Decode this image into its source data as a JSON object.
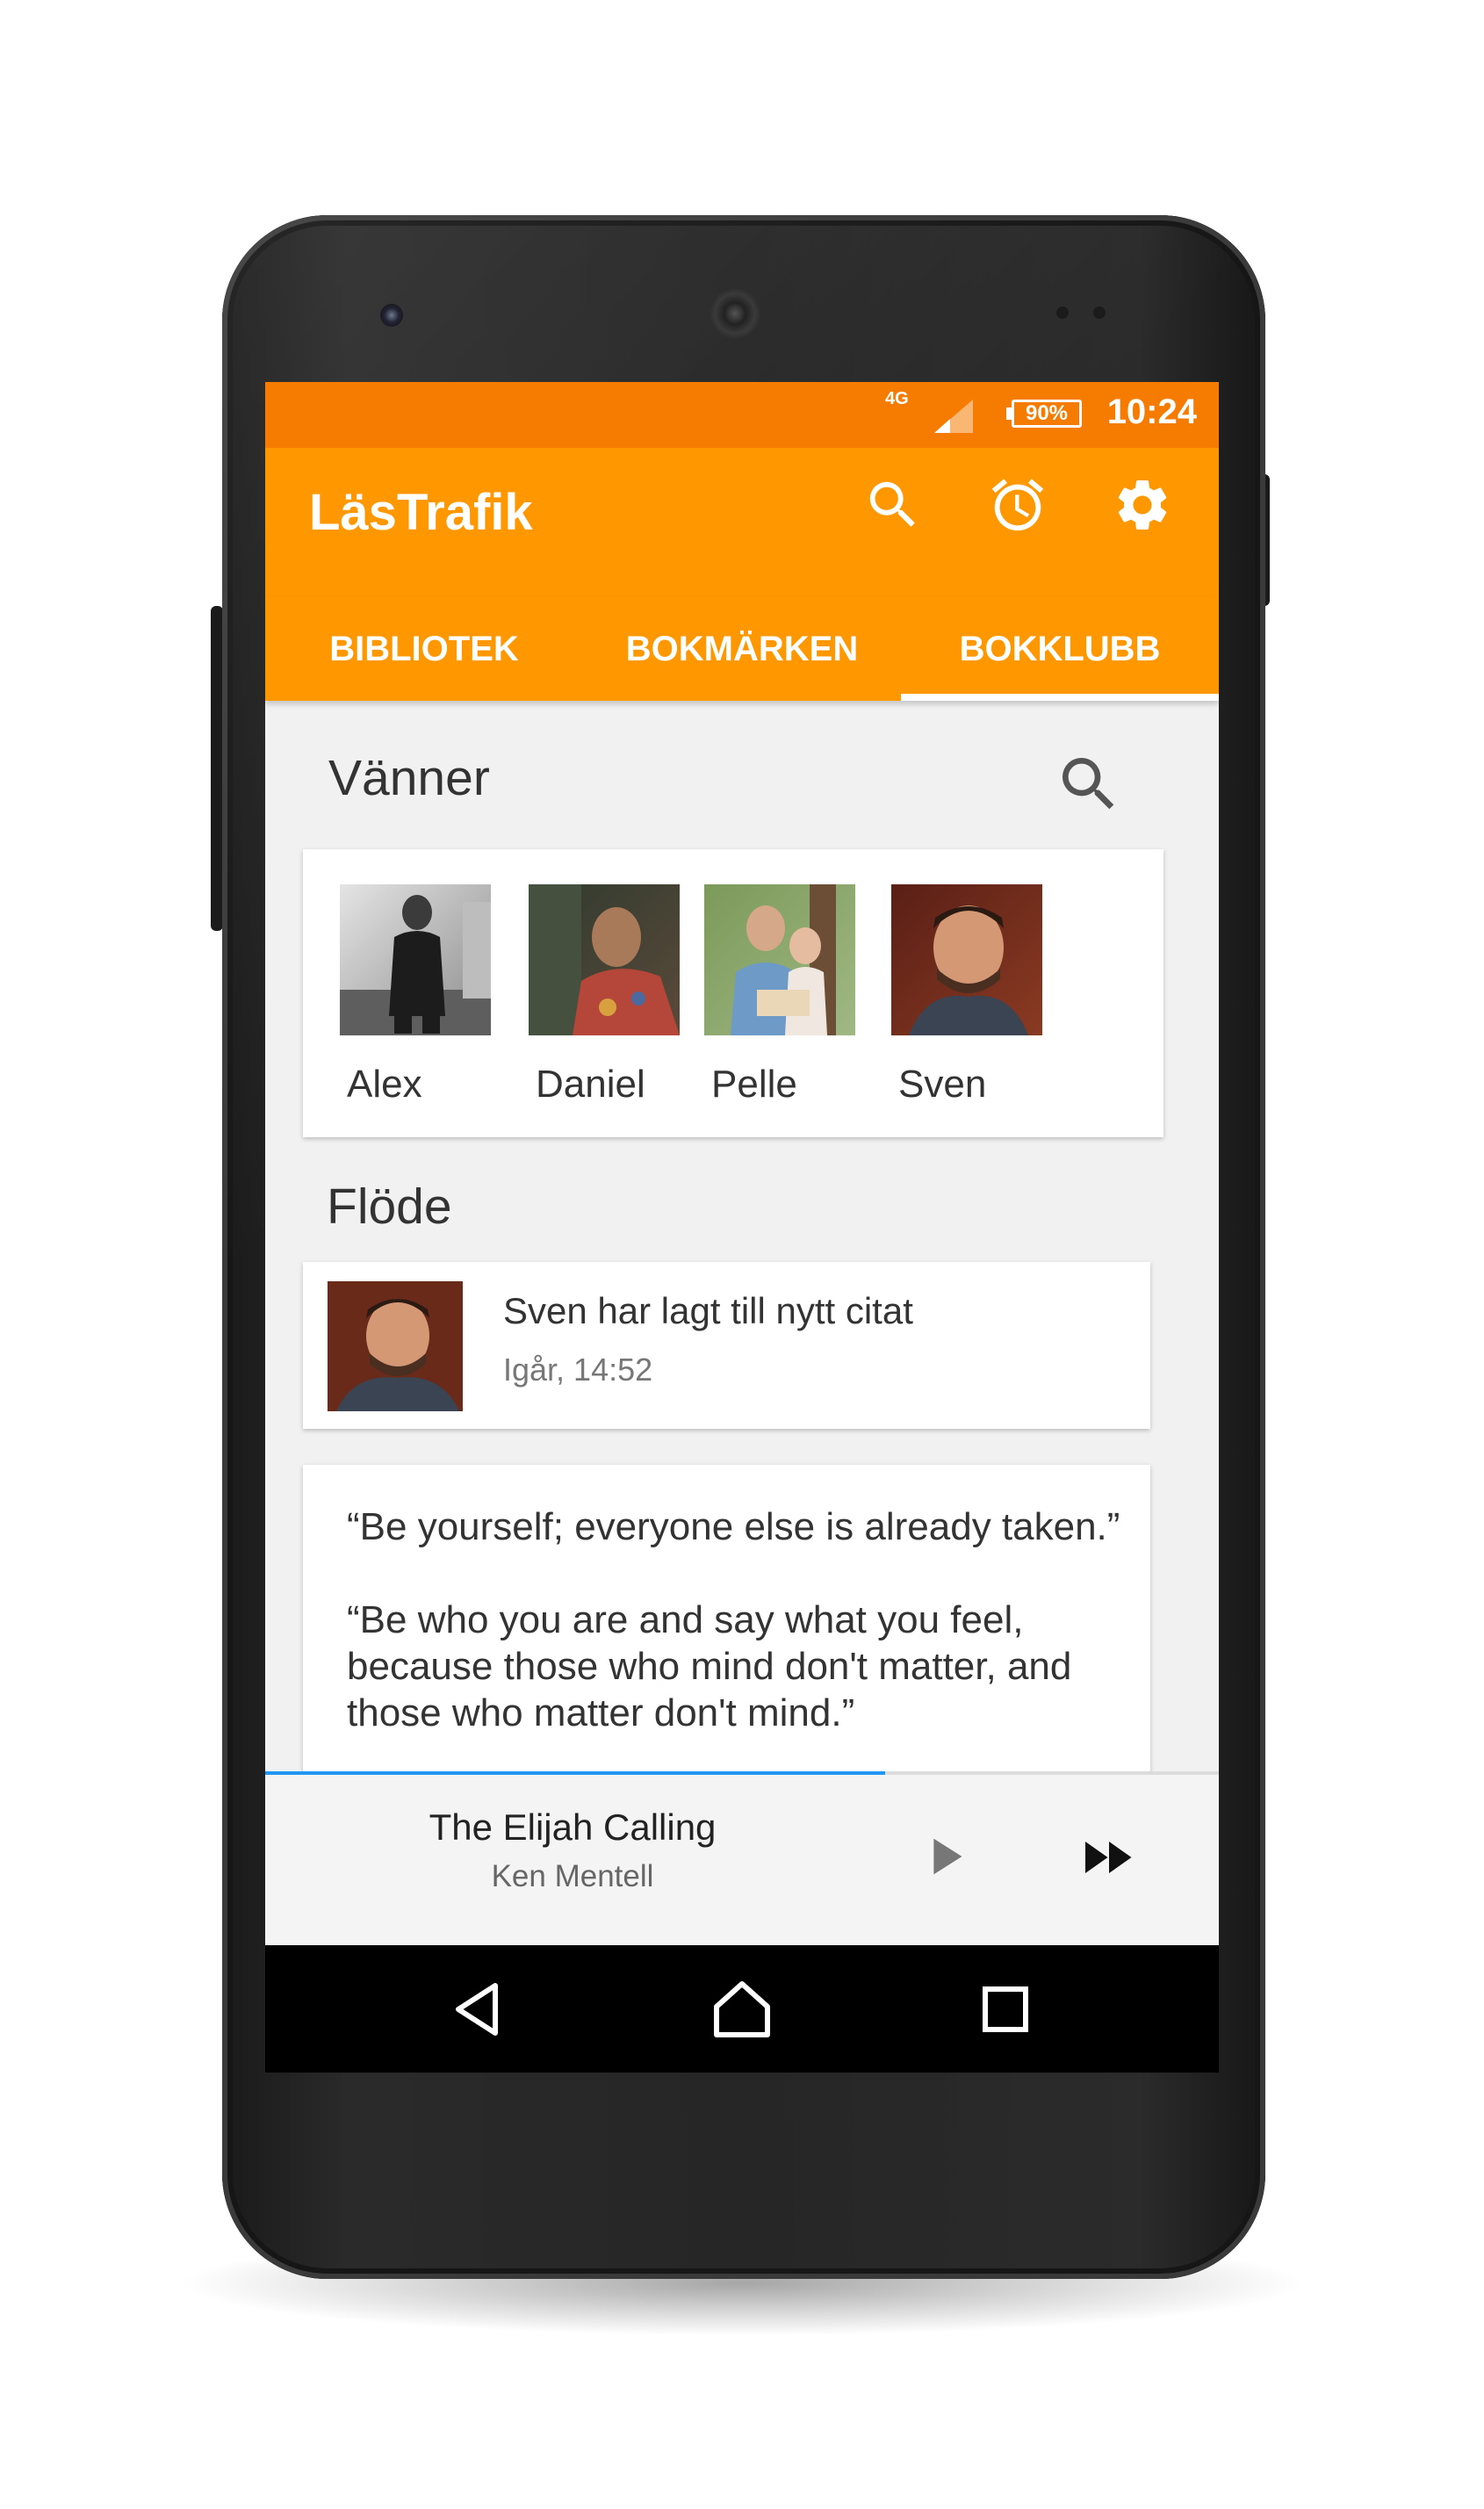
{
  "status_bar": {
    "network": "4G",
    "battery": "90%",
    "time": "10:24"
  },
  "app_bar": {
    "title": "LäsTrafik",
    "icons": [
      "search-icon",
      "alarm-icon",
      "settings-icon"
    ]
  },
  "tabs": [
    {
      "label": "BIBLIOTEK",
      "selected": false
    },
    {
      "label": "BOKMÄRKEN",
      "selected": false
    },
    {
      "label": "BOKKLUBB",
      "selected": true
    }
  ],
  "friends": {
    "title": "Vänner",
    "items": [
      {
        "name": "Alex"
      },
      {
        "name": "Daniel"
      },
      {
        "name": "Pelle"
      },
      {
        "name": "Sven"
      }
    ]
  },
  "feed": {
    "title": "Flöde",
    "items": [
      {
        "text": "Sven har lagt till nytt citat",
        "time": "Igår, 14:52"
      }
    ],
    "quotes": [
      "“Be yourself; everyone else is already taken.”",
      "“Be who you are and say what you feel, because those who mind don't matter, and those who matter don't mind.”"
    ]
  },
  "player": {
    "title": "The Elijah Calling",
    "author": "Ken Mentell",
    "progress": 0.65
  },
  "colors": {
    "primary": "#ff9800",
    "primary_dark": "#f57c00",
    "progress": "#2196f3"
  }
}
